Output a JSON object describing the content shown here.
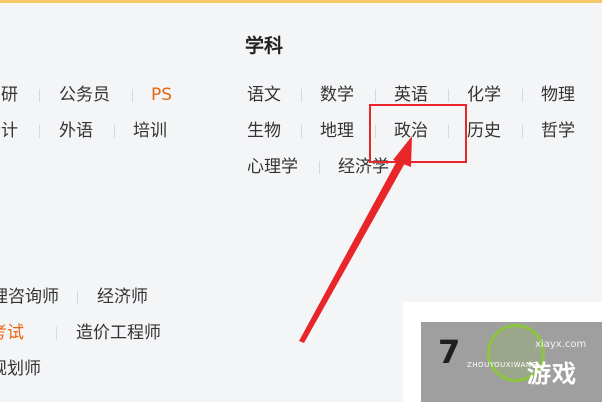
{
  "subjects": {
    "heading": "学科",
    "row1": [
      "语文",
      "数学",
      "英语",
      "化学",
      "物理"
    ],
    "row2": [
      "生物",
      "地理",
      "政治",
      "历史",
      "哲学"
    ],
    "row3": [
      "心理学",
      "经济学"
    ]
  },
  "left_top": {
    "row1": [
      "考研",
      "公务员",
      "PS"
    ],
    "row2": [
      "会计",
      "外语",
      "培训"
    ]
  },
  "left_bottom": {
    "row1": [
      "理咨询师",
      "经济师"
    ],
    "row2": [
      "考试",
      "造价工程师"
    ],
    "row3": [
      "规划师"
    ]
  },
  "watermark": {
    "number": "7",
    "site": "xiayx.com",
    "pinyin": "ZHOUYOUXIWANG",
    "game": "游戏"
  },
  "colors": {
    "accent": "#e8650f",
    "annotation": "#e8262a"
  }
}
